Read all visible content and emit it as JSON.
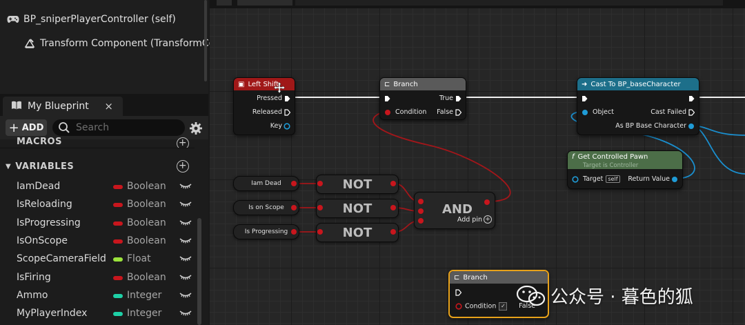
{
  "components": {
    "root_label": "BP_sniperPlayerController (self)",
    "child_label": "Transform Component (TransformCo"
  },
  "blueprint_panel": {
    "tab_label": "My Blueprint",
    "tab_close": "×",
    "add_label": "ADD",
    "search_placeholder": "Search",
    "macros_label": "MACROS",
    "variables_label": "VARIABLES",
    "variables": [
      {
        "name": "IamDead",
        "type": "Boolean",
        "color": "#c8161d"
      },
      {
        "name": "IsReloading",
        "type": "Boolean",
        "color": "#c8161d"
      },
      {
        "name": "IsProgressing",
        "type": "Boolean",
        "color": "#c8161d"
      },
      {
        "name": "IsOnScope",
        "type": "Boolean",
        "color": "#c8161d"
      },
      {
        "name": "ScopeCameraField",
        "type": "Float",
        "color": "#9be33c"
      },
      {
        "name": "IsFiring",
        "type": "Boolean",
        "color": "#c8161d"
      },
      {
        "name": "Ammo",
        "type": "Integer",
        "color": "#1ed0a6"
      },
      {
        "name": "MyPlayerIndex",
        "type": "Integer",
        "color": "#1ed0a6"
      }
    ]
  },
  "graph": {
    "left_shift": {
      "title": "Left Shift",
      "pressed": "Pressed",
      "released": "Released",
      "key": "Key",
      "header_color": "#a01818"
    },
    "branch1": {
      "title": "Branch",
      "true_label": "True",
      "false_label": "False",
      "condition": "Condition",
      "header_color": "#5a5a5a"
    },
    "cast": {
      "title": "Cast To BP_baseCharacter",
      "object": "Object",
      "cast_failed": "Cast Failed",
      "as_label": "As BP Base Character",
      "header_color": "#1d6f8a"
    },
    "get_pawn": {
      "title": "Get Controlled Pawn",
      "subtitle": "Target is Controller",
      "target": "Target",
      "self": "self",
      "return_value": "Return Value",
      "header_color": "#4c6e48"
    },
    "getters": [
      "Iam Dead",
      "Is on Scope",
      "Is Progressing"
    ],
    "not_label": "NOT",
    "and_label": "AND",
    "add_pin": "Add pin",
    "branch2": {
      "title": "Branch",
      "condition": "Condition",
      "false_label": "False"
    }
  },
  "watermark": "公众号 · 暮色的狐",
  "colors": {
    "exec": "#ffffff",
    "bool": "#c8161d",
    "object": "#1f9bd6",
    "float": "#9be33c",
    "int": "#1ed0a6"
  }
}
